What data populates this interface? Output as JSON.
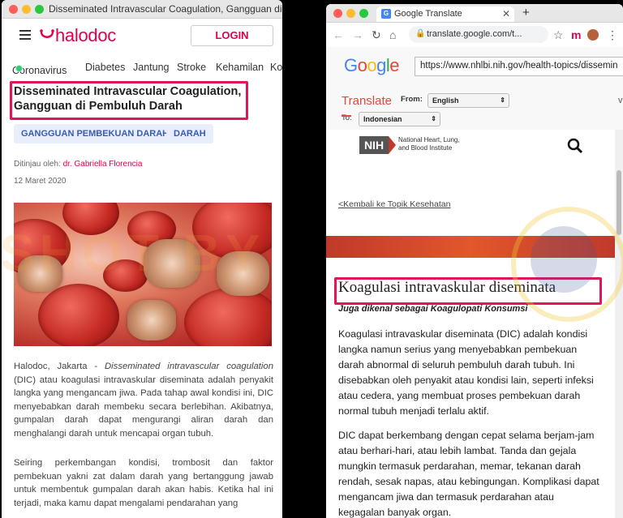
{
  "left_window": {
    "title": "Disseminated Intravascular Coagulation, Gangguan di P...",
    "logo": "halodoc",
    "login_label": "LOGIN",
    "nav": [
      "Coronavirus",
      "Diabetes",
      "Jantung",
      "Stroke",
      "Kehamilan",
      "Ko"
    ],
    "article_title": "Disseminated Intravascular Coagulation, Gangguan di Pembuluh Darah",
    "tags": [
      "GANGGUAN PEMBEKUAN DARAH",
      "DARAH"
    ],
    "reviewed_prefix": "Ditinjau oleh:",
    "reviewer": "dr. Gabriella Florencia",
    "date": "12 Maret 2020",
    "para1_lead": "Halodoc, Jakarta - ",
    "para1_italic": "Disseminated intravascular coagulation",
    "para1_rest": " (DIC) atau koagulasi intravaskular diseminata adalah penyakit langka yang mengancam jiwa. Pada tahap awal kondisi ini, DIC menyebabkan darah membeku secara berlebihan. Akibatnya, gumpalan darah dapat mengurangi aliran darah dan menghalangi darah untuk mencapai organ tubuh.",
    "para2": "Seiring perkembangan kondisi, trombosit dan faktor pembekuan yakni zat dalam darah yang bertanggung jawab untuk membentuk gumpalan darah akan habis. Ketika hal ini terjadi, maka kamu dapat mengalami pendarahan yang"
  },
  "right_window": {
    "tab_title": "Google Translate",
    "omnibox_url": "translate.google.com/t...",
    "google_logo": "Google",
    "source_url": "https://www.nhlbi.nih.gov/health-topics/dissemin",
    "translate_label": "Translate",
    "from_label": "From:",
    "from_value": "English",
    "to_label": "To:",
    "to_value": "Indonesian",
    "nih_short": "NIH",
    "nih_name_1": "National Heart, Lung,",
    "nih_name_2": "and Blood Institute",
    "back_link": "<Kembali ke Topik Kesehatan",
    "page_title": "Koagulasi intravaskular diseminata",
    "subtitle": "Juga dikenal sebagai Koagulopati Konsumsi",
    "para1": "Koagulasi intravaskular diseminata (DIC) adalah kondisi langka namun serius yang menyebabkan pembekuan darah abnormal di seluruh pembuluh darah tubuh. Ini disebabkan oleh penyakit atau kondisi lain, seperti infeksi atau cedera, yang membuat proses pembekuan darah normal tubuh menjadi terlalu aktif.",
    "para2": "DIC dapat berkembang dengan cepat selama berjam-jam atau berhari-hari, atau lebih lambat. Tanda dan gejala mungkin termasuk perdarahan, memar, tekanan darah rendah, sesak napas, atau kebingungan. Komplikasi dapat mengancam jiwa dan termasuk perdarahan atau kegagalan banyak organ."
  },
  "watermark": "SHOT BY",
  "colors": {
    "halodoc_brand": "#e0004d",
    "highlight": "#e0155c",
    "nih_red": "#c0392b"
  }
}
